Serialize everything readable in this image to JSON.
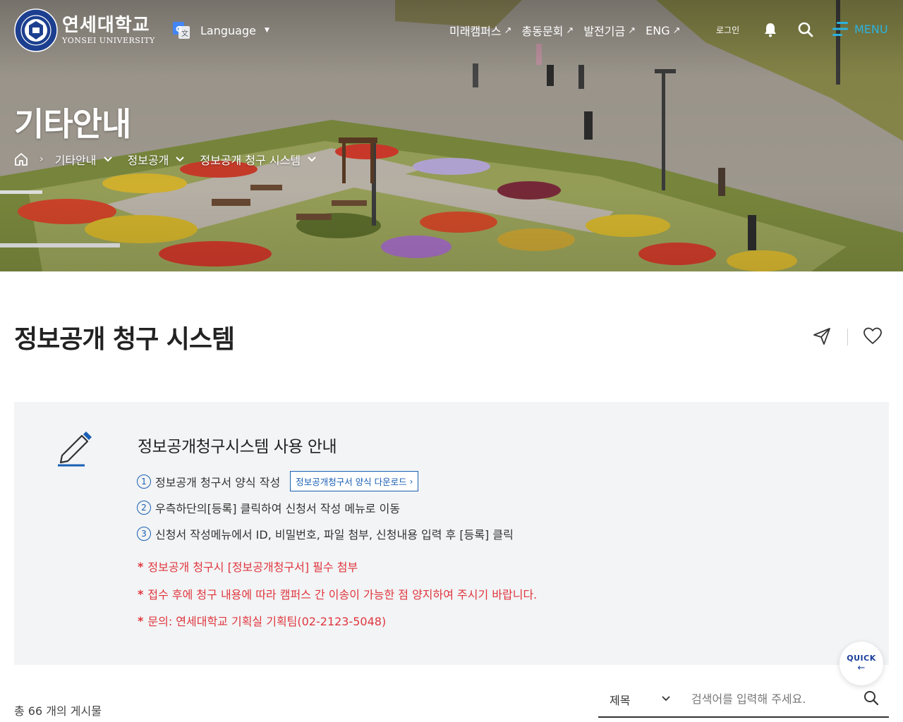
{
  "header": {
    "logo_ko": "연세대학교",
    "logo_en": "YONSEI UNIVERSITY",
    "language_label": "Language",
    "nav": [
      {
        "label": "미래캠퍼스"
      },
      {
        "label": "총동문회"
      },
      {
        "label": "발전기금"
      },
      {
        "label": "ENG"
      }
    ],
    "login_label": "로그인",
    "menu_label": "MENU"
  },
  "hero": {
    "title": "기타안내",
    "breadcrumb": [
      "기타안내",
      "정보공개",
      "정보공개 청구 시스템"
    ]
  },
  "page": {
    "title": "정보공개 청구 시스템"
  },
  "guide": {
    "title": "정보공개청구시스템 사용 안내",
    "steps": [
      {
        "num": "1",
        "text": "정보공개 청구서 양식 작성"
      },
      {
        "num": "2",
        "text": "우측하단의[등록] 클릭하여 신청서 작성 메뉴로 이동"
      },
      {
        "num": "3",
        "text": "신청서 작성메뉴에서 ID, 비밀번호, 파일 첨부, 신청내용 입력 후 [등록] 클릭"
      }
    ],
    "download_label": "정보공개청구서 양식 다운로드",
    "notes": [
      "정보공개 청구시 [정보공개청구서] 필수 첨부",
      "접수 후에 청구 내용에 따라 캠퍼스 간 이송이 가능한 점 양지하여 주시기 바랍니다.",
      "문의: 연세대학교 기획실 기획팀(02-2123-5048)"
    ]
  },
  "quick": {
    "label": "QUICK"
  },
  "list": {
    "total_text": "총 66 개의 게시물",
    "select_value": "제목",
    "search_placeholder": "검색어를 입력해 주세요."
  },
  "colors": {
    "accent_blue": "#1a5fb4",
    "menu_cyan": "#2ab3e0",
    "note_red": "#e0363e",
    "box_bg": "#f2f4f5"
  }
}
